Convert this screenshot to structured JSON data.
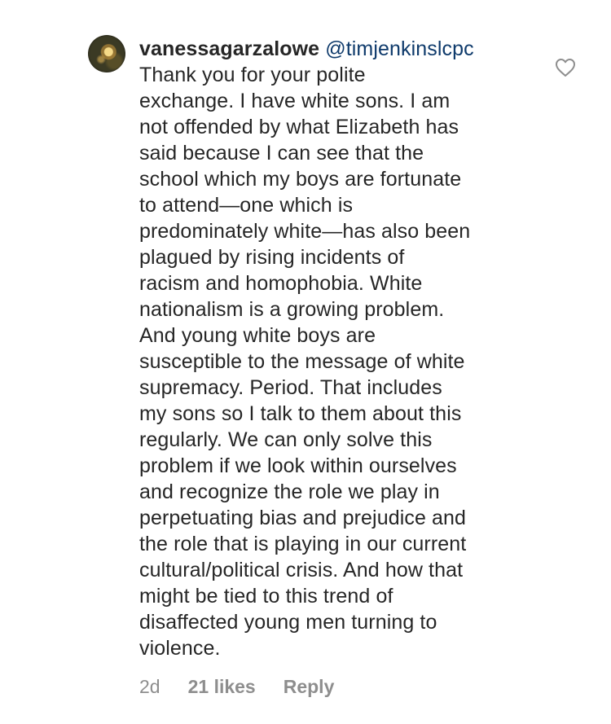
{
  "comment": {
    "username": "vanessagarzalowe",
    "mention": "@timjenkinslcpc",
    "text": "Thank you  for your polite\nexchange. I have white sons. I am\nnot offended by what Elizabeth has\nsaid because  I can see that the\nschool which my boys are fortunate\nto attend—one which is\npredominately white—has also been\nplagued by rising incidents of\nracism and homophobia. White\nnationalism is a growing problem.\nAnd young white boys are\nsusceptible to the message of white\nsupremacy. Period.  That includes\nmy sons so I talk to them about this\nregularly. We can only solve this\nproblem if we look within ourselves\nand recognize the role we play in\nperpetuating bias and prejudice and\nthe role that is playing in our current\ncultural/political crisis. And how that\nmight be tied to this trend of\ndisaffected young men turning to\nviolence.",
    "time": "2d",
    "likes": "21 likes",
    "reply_label": "Reply"
  },
  "icons": {
    "like": "heart-outline-icon",
    "avatar": "profile-avatar"
  }
}
